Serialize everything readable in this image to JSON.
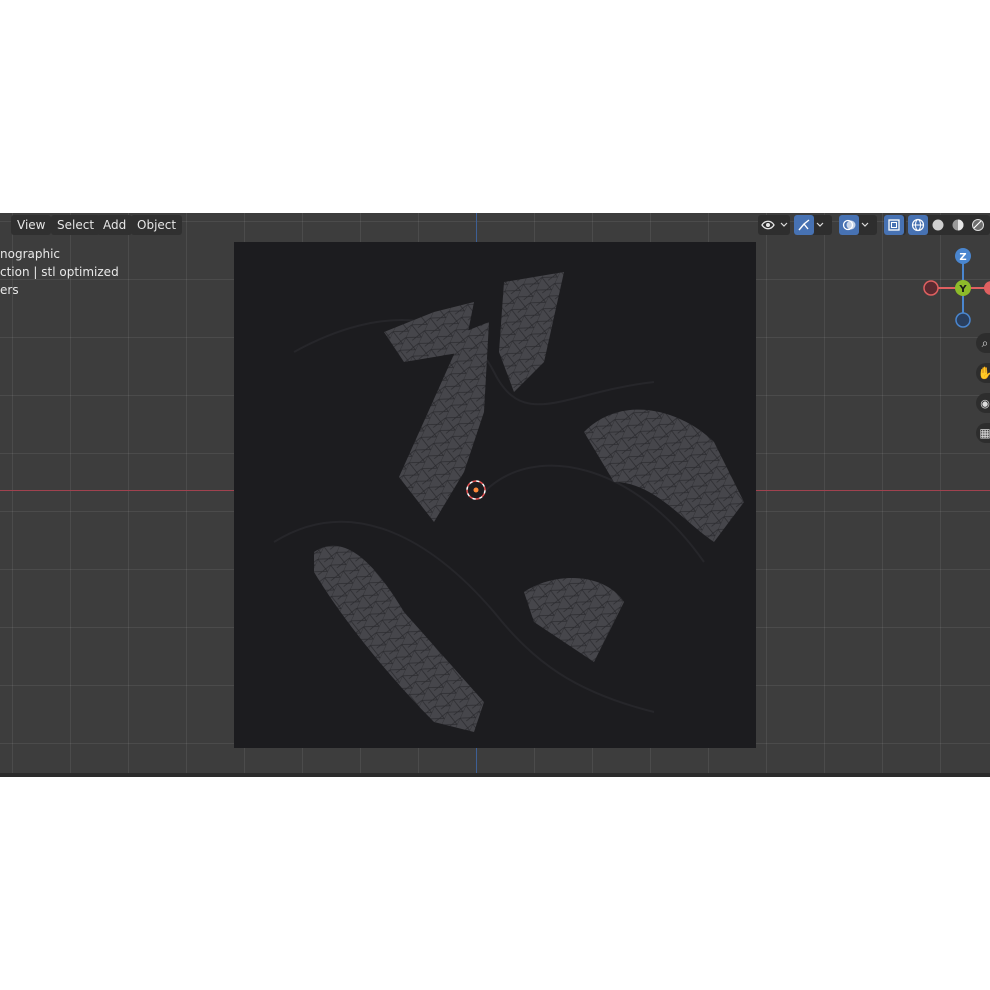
{
  "header": {
    "menu": [
      {
        "label": "View"
      },
      {
        "label": "Select"
      },
      {
        "label": "Add"
      },
      {
        "label": "Object"
      }
    ],
    "icons": {
      "visibility": "eye-icon",
      "gizmo": "gizmo-icon",
      "overlay": "overlay-icon",
      "xray": "xray-icon",
      "shading_wireframe": "wireframe-shading-icon",
      "shading_solid": "solid-shading-icon",
      "shading_material": "material-shading-icon",
      "shading_rendered": "rendered-shading-icon"
    },
    "accent_color": "#4772b3"
  },
  "overlay": {
    "view_name": "nographic",
    "collection_info": "ction | stl optimized",
    "units": "ers"
  },
  "gizmo": {
    "z_label": "Z",
    "y_label": "Y",
    "colors": {
      "x": "#e06060",
      "y": "#8dbb2a",
      "z": "#4a86cf"
    }
  },
  "navigation": {
    "icons": [
      "zoom-icon",
      "pan-icon",
      "camera-icon",
      "grid-icon"
    ]
  },
  "axes": {
    "x_color": "#a0424f",
    "y_color": "#3d5f95"
  }
}
